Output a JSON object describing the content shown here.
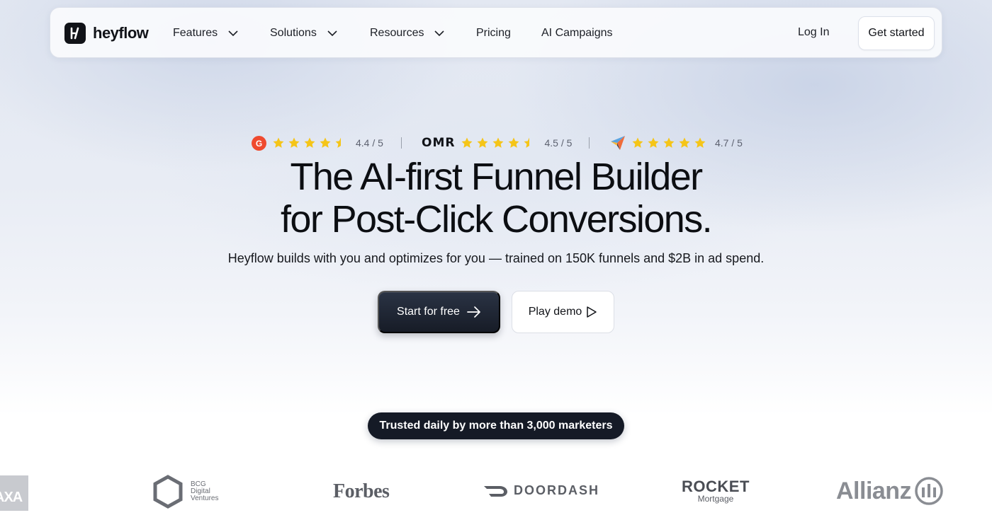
{
  "nav": {
    "brand": "heyflow",
    "items": [
      {
        "label": "Features",
        "has_dropdown": true
      },
      {
        "label": "Solutions",
        "has_dropdown": true
      },
      {
        "label": "Resources",
        "has_dropdown": true
      },
      {
        "label": "Pricing",
        "has_dropdown": false
      },
      {
        "label": "AI Campaigns",
        "has_dropdown": false
      }
    ],
    "login": "Log In",
    "get_started": "Get started"
  },
  "ratings": [
    {
      "source_icon": "g2-icon",
      "stars": 4.5,
      "score": "4.4 / 5"
    },
    {
      "source": "OMR",
      "stars": 4.5,
      "score": "4.5 / 5"
    },
    {
      "source_icon": "capterra-icon",
      "stars": 5,
      "score": "4.7 / 5"
    }
  ],
  "hero": {
    "title_line1": "The AI-first Funnel Builder",
    "title_line2": "for Post-Click Conversions.",
    "subtitle": "Heyflow builds with you and optimizes for you — trained on 150K funnels and $2B in ad spend.",
    "primary_cta": "Start for free",
    "secondary_cta": "Play demo"
  },
  "trusted_badge": "Trusted daily by more than 3,000 marketers",
  "logos": {
    "bcg": [
      "BCG",
      "Digital",
      "Ventures"
    ],
    "forbes": "Forbes",
    "doordash": "DOORDASH",
    "rocket": "ROCKET",
    "rocket_sub": "Mortgage",
    "allianz": "Allianz",
    "axa": "AXA"
  },
  "colors": {
    "primary_button": "#171c27",
    "star": "#f5c518",
    "g2": "#ef4a2f"
  }
}
